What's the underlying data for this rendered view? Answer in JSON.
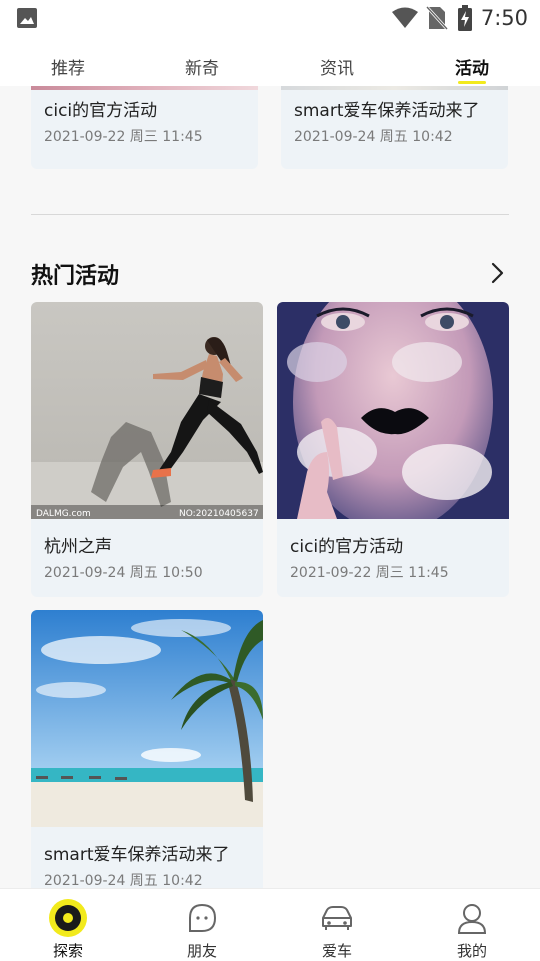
{
  "status_bar": {
    "time": "7:50",
    "icons": [
      "image-icon",
      "wifi-icon",
      "no-sim-icon",
      "battery-charging-icon"
    ]
  },
  "top_tabs": [
    {
      "label": "推荐",
      "active": false
    },
    {
      "label": "新奇",
      "active": false
    },
    {
      "label": "资讯",
      "active": false
    },
    {
      "label": "活动",
      "active": true
    }
  ],
  "partial_cards": [
    {
      "title": "cici的官方活动",
      "date": "2021-09-22 周三 11:45"
    },
    {
      "title": "smart爱车保养活动来了",
      "date": "2021-09-24 周五 10:42"
    }
  ],
  "hot_section": {
    "title": "热门活动",
    "more_icon": "chevron-right-icon",
    "cards": [
      {
        "title": "杭州之声",
        "date": "2021-09-24 周五 10:50",
        "image": "runner-photo",
        "watermark_left": "DALMG.com",
        "watermark_right": "NO:20210405637"
      },
      {
        "title": "cici的官方活动",
        "date": "2021-09-22 周三 11:45",
        "image": "face-clouds-photo"
      },
      {
        "title": "smart爱车保养活动来了",
        "date": "2021-09-24 周五 10:42",
        "image": "beach-palm-photo"
      }
    ]
  },
  "bottom_nav": [
    {
      "label": "探索",
      "icon": "explore-icon",
      "active": true
    },
    {
      "label": "朋友",
      "icon": "chat-bubble-icon",
      "active": false
    },
    {
      "label": "爱车",
      "icon": "car-icon",
      "active": false
    },
    {
      "label": "我的",
      "icon": "user-icon",
      "active": false
    }
  ],
  "colors": {
    "accent": "#f2ea1c",
    "card_bg": "#eef3f7",
    "page_bg": "#f7f7f7"
  }
}
